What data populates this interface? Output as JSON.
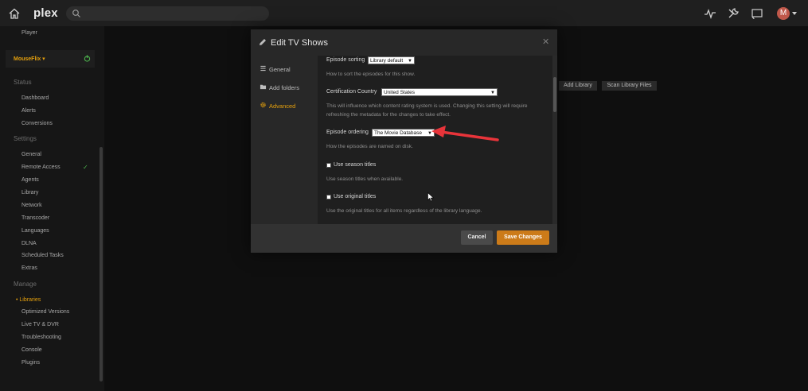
{
  "topbar": {
    "logo_text": "plex",
    "avatar_initial": "M"
  },
  "sidebar": {
    "player": "Player",
    "server_name": "MouseFlix ▾",
    "status_header": "Status",
    "status_items": [
      "Dashboard",
      "Alerts",
      "Conversions"
    ],
    "settings_header": "Settings",
    "settings_items": [
      "General",
      "Remote Access",
      "Agents",
      "Library",
      "Network",
      "Transcoder",
      "Languages",
      "DLNA",
      "Scheduled Tasks",
      "Extras"
    ],
    "manage_header": "Manage",
    "manage_items": [
      "• Libraries",
      "Optimized Versions",
      "Live TV & DVR",
      "Troubleshooting",
      "Console",
      "Plugins"
    ],
    "remote_access_check": "✓"
  },
  "main": {
    "add_library": "Add Library",
    "scan_library_files": "Scan Library Files"
  },
  "modal": {
    "title": "Edit TV Shows",
    "close": "✕",
    "nav": [
      {
        "label": "General"
      },
      {
        "label": "Add folders"
      },
      {
        "label": "Advanced"
      }
    ],
    "episode_sorting": {
      "label": "Episode sorting",
      "value": "Library default",
      "help": "How to sort the episodes for this show."
    },
    "certification_country": {
      "label": "Certification Country",
      "value": "United States",
      "help": "This will influence which content rating system is used. Changing this setting will require refreshing the metadata for the changes to take effect."
    },
    "episode_ordering": {
      "label": "Episode ordering",
      "value": "The Movie Database",
      "help": "How the episodes are named on disk."
    },
    "season_titles": {
      "label": "Use season titles",
      "help": "Use season titles when available."
    },
    "original_titles": {
      "label": "Use original titles",
      "help": "Use the original titles for all items regardless of the library language."
    },
    "cancel": "Cancel",
    "save": "Save Changes"
  },
  "colors": {
    "accent": "#e5a00d",
    "save_button": "#cc7b19",
    "arrow": "#e8343a"
  }
}
